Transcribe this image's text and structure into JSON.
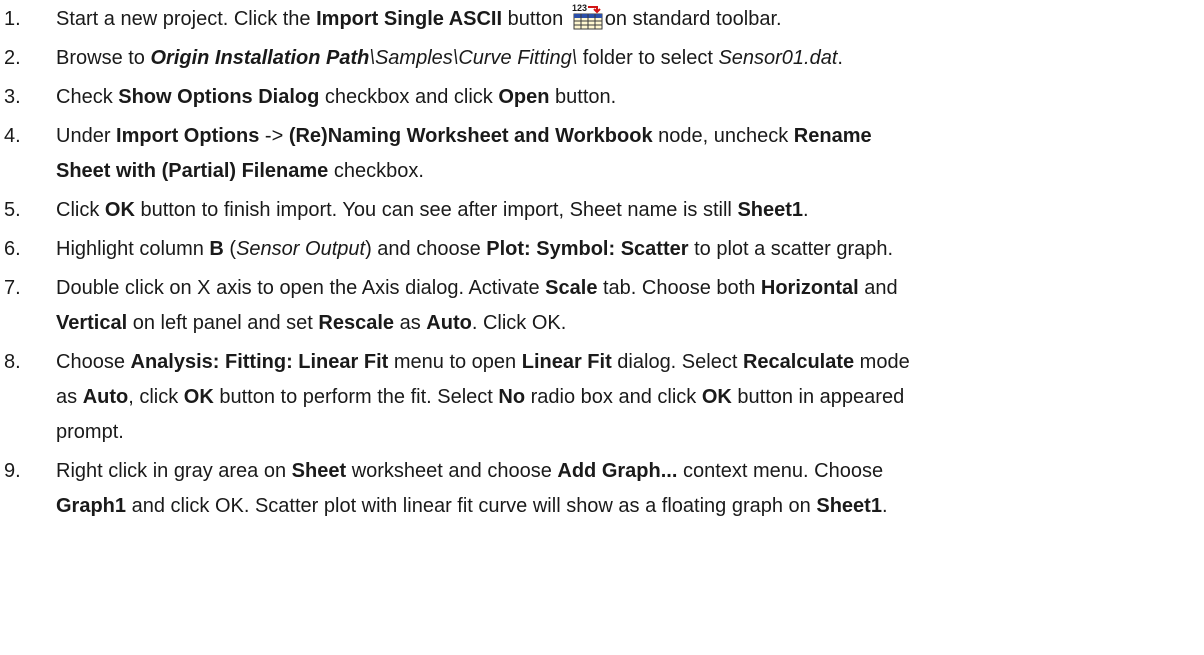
{
  "steps": [
    {
      "number": "1.",
      "parts": [
        {
          "t": "Start a new project. Click the "
        },
        {
          "t": "Import Single ASCII",
          "b": true
        },
        {
          "t": " button "
        },
        {
          "icon": "import-single-ascii-icon",
          "label": "123"
        },
        {
          "t": "on standard toolbar."
        }
      ]
    },
    {
      "number": "2.",
      "parts": [
        {
          "t": "Browse to "
        },
        {
          "t": "Origin Installation Path",
          "b": true,
          "i": true
        },
        {
          "t": "\\Samples\\Curve Fitting\\",
          "i": true
        },
        {
          "t": " folder to select "
        },
        {
          "t": "Sensor01.dat",
          "i": true
        },
        {
          "t": "."
        }
      ]
    },
    {
      "number": "3.",
      "parts": [
        {
          "t": "Check "
        },
        {
          "t": "Show Options Dialog",
          "b": true
        },
        {
          "t": " checkbox and click "
        },
        {
          "t": "Open",
          "b": true
        },
        {
          "t": " button."
        }
      ]
    },
    {
      "number": "4.",
      "parts": [
        {
          "t": "Under "
        },
        {
          "t": "Import Options",
          "b": true
        },
        {
          "t": " -> "
        },
        {
          "t": "(Re)Naming Worksheet and Workbook",
          "b": true
        },
        {
          "t": " node, uncheck "
        },
        {
          "t": "Rename",
          "b": true
        },
        {
          "br": true
        },
        {
          "t": "Sheet with (Partial) Filename",
          "b": true
        },
        {
          "t": " checkbox."
        }
      ]
    },
    {
      "number": "5.",
      "parts": [
        {
          "t": "Click "
        },
        {
          "t": "OK",
          "b": true
        },
        {
          "t": " button to finish import. You can see after import, Sheet name is still "
        },
        {
          "t": "Sheet1",
          "b": true
        },
        {
          "t": "."
        }
      ]
    },
    {
      "number": "6.",
      "parts": [
        {
          "t": "Highlight column "
        },
        {
          "t": "B",
          "b": true
        },
        {
          "t": " ("
        },
        {
          "t": "Sensor Output",
          "i": true
        },
        {
          "t": ") and choose "
        },
        {
          "t": "Plot: Symbol: Scatter",
          "b": true
        },
        {
          "t": " to plot a scatter graph."
        }
      ]
    },
    {
      "number": "7.",
      "parts": [
        {
          "t": "Double click on X axis to open the Axis dialog. Activate "
        },
        {
          "t": "Scale",
          "b": true
        },
        {
          "t": " tab. Choose both "
        },
        {
          "t": "Horizontal",
          "b": true
        },
        {
          "t": " and"
        },
        {
          "br": true
        },
        {
          "t": "Vertical",
          "b": true
        },
        {
          "t": " on left panel and set "
        },
        {
          "t": "Rescale",
          "b": true
        },
        {
          "t": " as "
        },
        {
          "t": "Auto",
          "b": true
        },
        {
          "t": ". Click OK."
        }
      ]
    },
    {
      "number": "8.",
      "parts": [
        {
          "t": "Choose "
        },
        {
          "t": "Analysis: Fitting: Linear Fit",
          "b": true
        },
        {
          "t": " menu to open "
        },
        {
          "t": "Linear Fit",
          "b": true
        },
        {
          "t": " dialog. Select "
        },
        {
          "t": "Recalculate",
          "b": true
        },
        {
          "t": " mode"
        },
        {
          "br": true
        },
        {
          "t": "as "
        },
        {
          "t": "Auto",
          "b": true
        },
        {
          "t": ", click "
        },
        {
          "t": "OK",
          "b": true
        },
        {
          "t": " button to perform the fit. Select "
        },
        {
          "t": "No",
          "b": true
        },
        {
          "t": " radio box and click "
        },
        {
          "t": "OK",
          "b": true
        },
        {
          "t": " button in appeared"
        },
        {
          "br": true
        },
        {
          "t": "prompt."
        }
      ]
    },
    {
      "number": "9.",
      "parts": [
        {
          "t": "Right click in gray area on "
        },
        {
          "t": "Sheet",
          "b": true
        },
        {
          "t": " worksheet and choose "
        },
        {
          "t": "Add Graph...",
          "b": true
        },
        {
          "t": " context menu. Choose"
        },
        {
          "br": true
        },
        {
          "t": "Graph1",
          "b": true
        },
        {
          "t": " and click OK. Scatter plot with linear fit curve will show as a floating graph on "
        },
        {
          "t": "Sheet1",
          "b": true
        },
        {
          "t": "."
        }
      ]
    }
  ]
}
